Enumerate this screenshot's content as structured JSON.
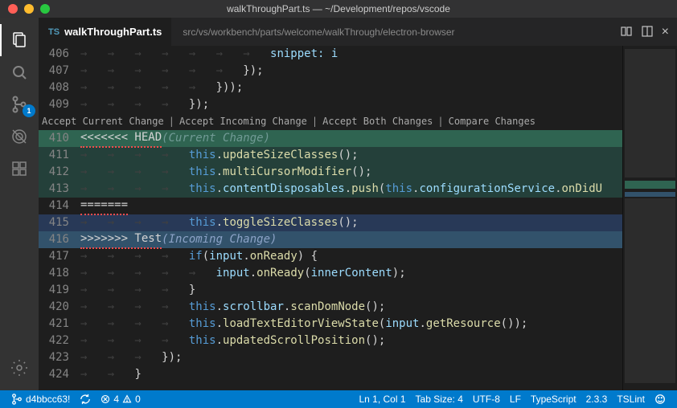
{
  "window": {
    "title": "walkThroughPart.ts — ~/Development/repos/vscode"
  },
  "activity": {
    "scm_badge": "1"
  },
  "tab": {
    "icon": "TS",
    "label": "walkThroughPart.ts",
    "breadcrumb": "src/vs/workbench/parts/welcome/walkThrough/electron-browser"
  },
  "codelens": {
    "accept_current": "Accept Current Change",
    "accept_incoming": "Accept Incoming Change",
    "accept_both": "Accept Both Changes",
    "compare": "Compare Changes"
  },
  "merge": {
    "head_marker": "<<<<<<< HEAD",
    "head_label": "(Current Change)",
    "sep_marker": "=======",
    "incoming_marker": ">>>>>>> Test",
    "incoming_label": "(Incoming Change)"
  },
  "code": {
    "l406": "snippet: i",
    "l411_fn": "updateSizeClasses",
    "l412_fn": "multiCursorModifier",
    "l413a": "contentDisposables",
    "l413b": "push",
    "l413c": "configurationService",
    "l413d": "onDidU",
    "l415_fn": "toggleSizeClasses",
    "l417_if": "if",
    "l417_input": "input",
    "l417_onReady": "onReady",
    "l418_arg": "innerContent",
    "l420_a": "scrollbar",
    "l420_b": "scanDomNode",
    "l421_a": "loadTextEditorViewState",
    "l421_b": "getResource",
    "l422_a": "updatedScrollPosition"
  },
  "line_numbers": [
    "406",
    "407",
    "408",
    "409",
    "410",
    "411",
    "412",
    "413",
    "414",
    "415",
    "416",
    "417",
    "418",
    "419",
    "420",
    "421",
    "422",
    "423",
    "424"
  ],
  "status": {
    "branch": "d4bbcc63!",
    "sync": "0",
    "errors": "4",
    "warnings": "0",
    "ln_col": "Ln 1, Col 1",
    "tab_size": "Tab Size: 4",
    "encoding": "UTF-8",
    "eol": "LF",
    "language": "TypeScript",
    "tsver": "2.3.3",
    "tslint": "TSLint"
  },
  "colors": {
    "statusbar": "#007acc"
  }
}
